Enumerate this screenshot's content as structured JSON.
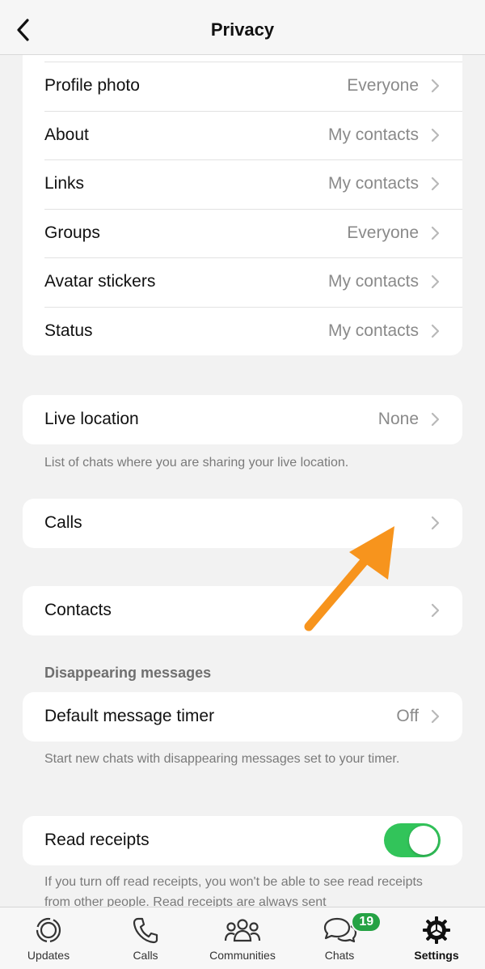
{
  "header": {
    "title": "Privacy"
  },
  "visibility": [
    {
      "label": "Profile photo",
      "value": "Everyone"
    },
    {
      "label": "About",
      "value": "My contacts"
    },
    {
      "label": "Links",
      "value": "My contacts"
    },
    {
      "label": "Groups",
      "value": "Everyone"
    },
    {
      "label": "Avatar stickers",
      "value": "My contacts"
    },
    {
      "label": "Status",
      "value": "My contacts"
    }
  ],
  "live_location": {
    "label": "Live location",
    "value": "None",
    "note": "List of chats where you are sharing your live location."
  },
  "calls": {
    "label": "Calls"
  },
  "contacts": {
    "label": "Contacts"
  },
  "disappearing": {
    "heading": "Disappearing messages",
    "label": "Default message timer",
    "value": "Off",
    "note": "Start new chats with disappearing messages set to your timer."
  },
  "read_receipts": {
    "label": "Read receipts",
    "enabled": true,
    "note": "If you turn off read receipts, you won't be able to see read receipts from other people. Read receipts are always sent"
  },
  "tabs": [
    {
      "label": "Updates",
      "icon": "updates-icon"
    },
    {
      "label": "Calls",
      "icon": "phone-icon"
    },
    {
      "label": "Communities",
      "icon": "communities-icon"
    },
    {
      "label": "Chats",
      "icon": "chats-icon",
      "badge": "19"
    },
    {
      "label": "Settings",
      "icon": "gear-icon",
      "active": true
    }
  ],
  "colors": {
    "accent_green": "#32c45a",
    "badge_green": "#25a244",
    "annotation_arrow": "#f7941d"
  }
}
